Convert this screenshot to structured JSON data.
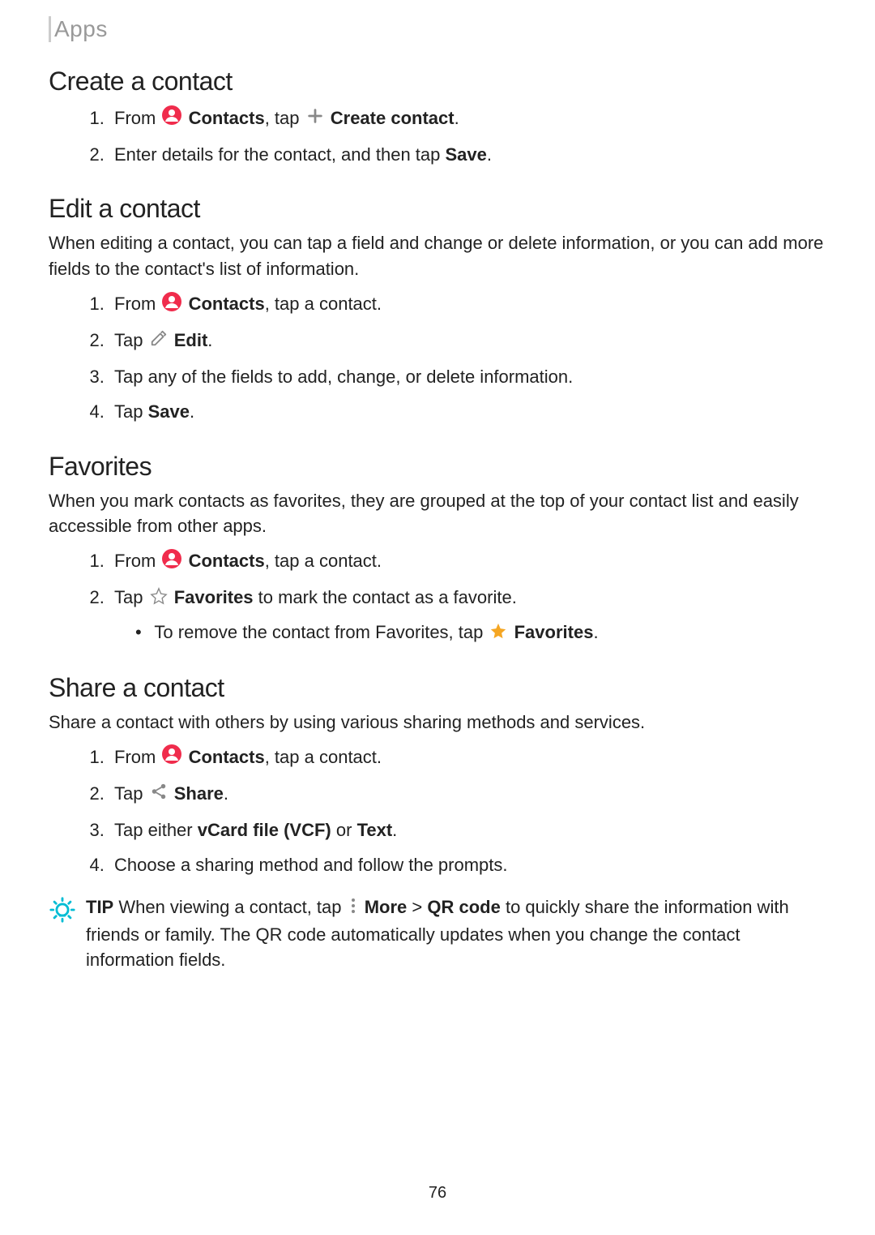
{
  "header": "Apps",
  "page_number": "76",
  "sections": {
    "create": {
      "title": "Create a contact",
      "step1": {
        "t1": "From ",
        "bold1": "Contacts",
        "t2": ", tap ",
        "bold2": "Create contact",
        "t3": "."
      },
      "step2": {
        "t1": "Enter details for the contact, and then tap ",
        "bold1": "Save",
        "t2": "."
      }
    },
    "edit": {
      "title": "Edit a contact",
      "desc": "When editing a contact, you can tap a field and change or delete information, or you can add more fields to the contact's list of information.",
      "step1": {
        "t1": "From ",
        "bold1": "Contacts",
        "t2": ", tap a contact."
      },
      "step2": {
        "t1": "Tap ",
        "bold1": "Edit",
        "t2": "."
      },
      "step3": "Tap any of the fields to add, change, or delete information.",
      "step4": {
        "t1": "Tap ",
        "bold1": "Save",
        "t2": "."
      }
    },
    "fav": {
      "title": "Favorites",
      "desc": "When you mark contacts as favorites, they are grouped at the top of your contact list and easily accessible from other apps.",
      "step1": {
        "t1": "From ",
        "bold1": "Contacts",
        "t2": ", tap a contact."
      },
      "step2": {
        "t1": "Tap ",
        "bold1": "Favorites",
        "t2": " to mark the contact as a favorite."
      },
      "sub": {
        "t1": "To remove the contact from Favorites, tap ",
        "bold1": "Favorites",
        "t2": "."
      }
    },
    "share": {
      "title": "Share a contact",
      "desc": "Share a contact with others by using various sharing methods and services.",
      "step1": {
        "t1": "From ",
        "bold1": "Contacts",
        "t2": ", tap a contact."
      },
      "step2": {
        "t1": "Tap ",
        "bold1": "Share",
        "t2": "."
      },
      "step3": {
        "t1": "Tap either ",
        "bold1": "vCard file (VCF)",
        "t2": " or ",
        "bold2": "Text",
        "t3": "."
      },
      "step4": "Choose a sharing method and follow the prompts."
    }
  },
  "tip": {
    "label": "TIP",
    "t1": " When viewing a contact, tap ",
    "bold1": "More",
    "t2": " > ",
    "bold2": "QR code",
    "t3": " to quickly share the information with friends or family. The QR code automatically updates when you change the contact information fields."
  }
}
